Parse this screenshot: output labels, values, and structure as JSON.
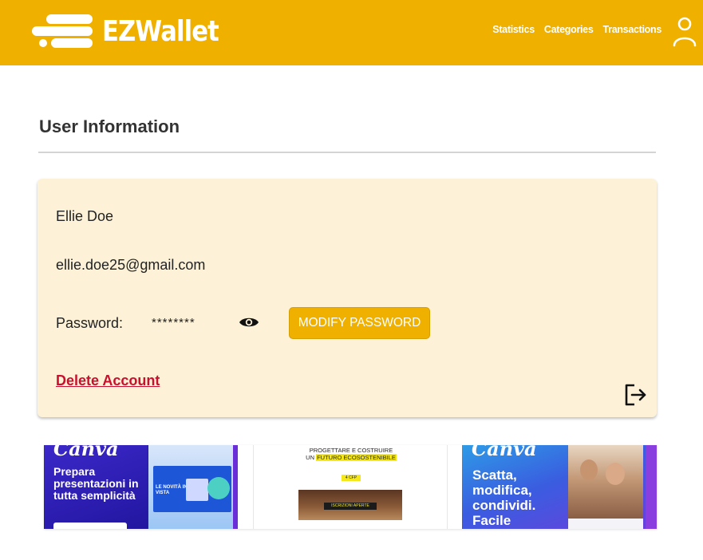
{
  "app": {
    "name": "EZWallet",
    "brand_color": "#f0b000"
  },
  "nav": {
    "items": [
      {
        "label": "Statistics"
      },
      {
        "label": "Categories"
      },
      {
        "label": "Transactions"
      }
    ],
    "user_icon": "user-icon"
  },
  "section": {
    "title": "User Information"
  },
  "user": {
    "name": "Ellie Doe",
    "email": "ellie.doe25@gmail.com",
    "password_label": "Password:",
    "password_masked": "********",
    "show_password_icon": "eye-icon",
    "modify_password_label": "MODIFY PASSWORD",
    "delete_account_label": "Delete Account",
    "logout_icon": "logout-icon"
  },
  "ads": [
    {
      "brand": "Canva",
      "headline": "Prepara presentazioni in tutta semplicità",
      "inner_label": "LE NOVITÀ IN VISTA"
    },
    {
      "headline_1": "PROGETTARE E COSTRUIRE",
      "headline_2_prefix": "UN ",
      "headline_2_highlight": "FUTURO ECOSOSTENIBILE",
      "badge_credits": "4 CFP",
      "badge_enroll": "ISCRIZIONI APERTE"
    },
    {
      "brand": "Canva",
      "headline": "Scatta, modifica, condividi. Facile"
    }
  ]
}
